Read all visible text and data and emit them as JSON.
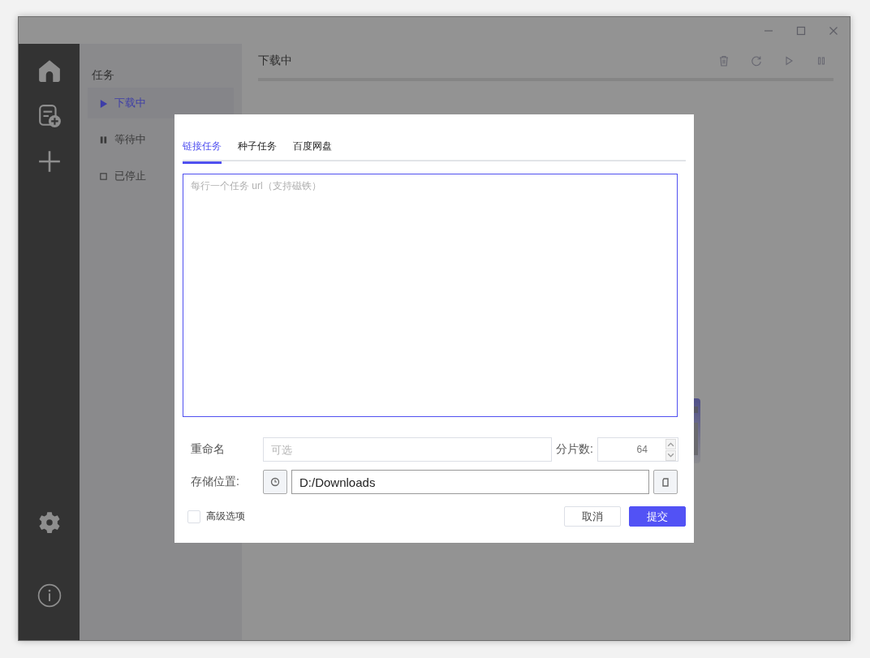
{
  "task_panel": {
    "title": "任务",
    "items": [
      {
        "label": "下载中",
        "kind": "downloading",
        "selected": true
      },
      {
        "label": "等待中",
        "kind": "waiting",
        "selected": false
      },
      {
        "label": "已停止",
        "kind": "stopped",
        "selected": false
      }
    ]
  },
  "main": {
    "title": "下载中"
  },
  "dialog": {
    "tabs": [
      {
        "label": "链接任务",
        "selected": true
      },
      {
        "label": "种子任务",
        "selected": false
      },
      {
        "label": "百度网盘",
        "selected": false
      }
    ],
    "url_field": {
      "placeholder": "每行一个任务 url（支持磁铁）"
    },
    "rename": {
      "label": "重命名",
      "placeholder": "可选"
    },
    "segments": {
      "label": "分片数:",
      "value": "64"
    },
    "location": {
      "label": "存储位置:",
      "value": "D:/Downloads"
    },
    "advanced": {
      "label": "高级选项",
      "checked": false
    },
    "buttons": [
      {
        "label": "取消",
        "kind": "secondary"
      },
      {
        "label": "提交",
        "kind": "primary"
      }
    ]
  }
}
